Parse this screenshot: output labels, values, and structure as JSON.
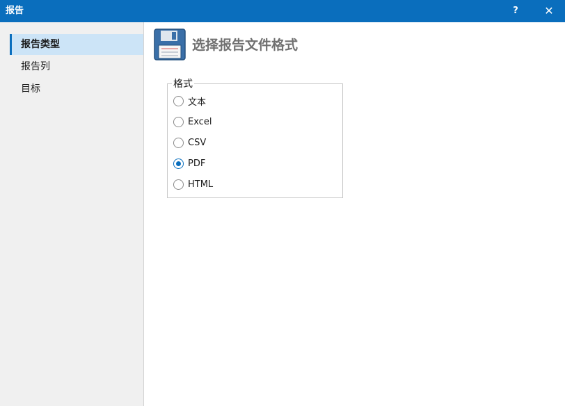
{
  "window": {
    "title": "报告",
    "help_label": "?",
    "close_label": "✕"
  },
  "sidebar": {
    "items": [
      {
        "label": "报告类型",
        "selected": true
      },
      {
        "label": "报告列",
        "selected": false
      },
      {
        "label": "目标",
        "selected": false
      }
    ]
  },
  "main": {
    "header_title": "选择报告文件格式",
    "header_icon": "floppy-disk-icon",
    "group": {
      "legend": "格式",
      "options": [
        {
          "label": "文本",
          "checked": false
        },
        {
          "label": "Excel",
          "checked": false
        },
        {
          "label": "CSV",
          "checked": false
        },
        {
          "label": "PDF",
          "checked": true
        },
        {
          "label": "HTML",
          "checked": false
        }
      ]
    }
  },
  "colors": {
    "accent": "#0a6ebd",
    "selection": "#cce4f7",
    "sidebar_bg": "#f0f0f0"
  }
}
